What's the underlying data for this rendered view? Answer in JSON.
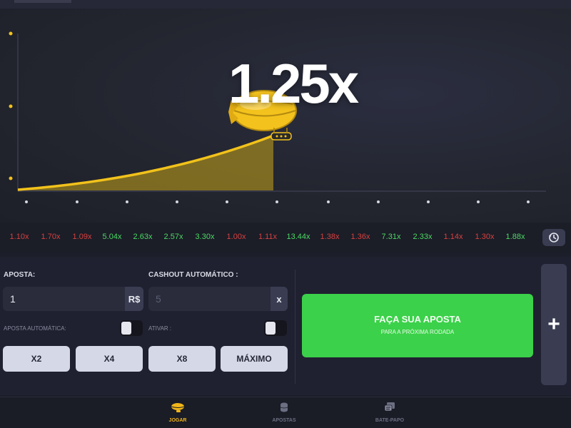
{
  "game": {
    "multiplier": "1.25x",
    "colors": {
      "curve": "#f2c21b",
      "fill": "#c8a61a",
      "background": "#23252f"
    }
  },
  "history": {
    "items": [
      {
        "value": "1.10x",
        "status": "red"
      },
      {
        "value": "1.70x",
        "status": "red"
      },
      {
        "value": "1.09x",
        "status": "red"
      },
      {
        "value": "5.04x",
        "status": "green"
      },
      {
        "value": "2.63x",
        "status": "green"
      },
      {
        "value": "2.57x",
        "status": "green"
      },
      {
        "value": "3.30x",
        "status": "green"
      },
      {
        "value": "1.00x",
        "status": "red"
      },
      {
        "value": "1.11x",
        "status": "red"
      },
      {
        "value": "13.44x",
        "status": "green"
      },
      {
        "value": "1.38x",
        "status": "red"
      },
      {
        "value": "1.36x",
        "status": "red"
      },
      {
        "value": "7.31x",
        "status": "green"
      },
      {
        "value": "2.33x",
        "status": "green"
      },
      {
        "value": "1.14x",
        "status": "red"
      },
      {
        "value": "1.30x",
        "status": "red"
      },
      {
        "value": "1.88x",
        "status": "green"
      }
    ],
    "button_icon": "history-icon"
  },
  "controls": {
    "bet_label": "APOSTA:",
    "bet_value": "1",
    "bet_currency": "R$",
    "cashout_label": "CASHOUT AUTOMÁTICO :",
    "cashout_placeholder": "5",
    "cashout_suffix": "x",
    "auto_bet_label": "APOSTA AUTOMÁTICA:",
    "activate_label": "ATIVAR :",
    "quick_buttons": [
      "X2",
      "X4",
      "X8",
      "MÁXIMO"
    ],
    "bet_button_main": "FAÇA SUA APOSTA",
    "bet_button_sub": "PARA A PRÓXIMA RODADA",
    "add_button_label": "+"
  },
  "bottom_nav": {
    "items": [
      {
        "label": "JOGAR",
        "icon": "blimp-icon",
        "active": true
      },
      {
        "label": "APOSTAS",
        "icon": "coins-icon",
        "active": false
      },
      {
        "label": "BATE-PAPO",
        "icon": "chat-icon",
        "active": false
      }
    ]
  }
}
